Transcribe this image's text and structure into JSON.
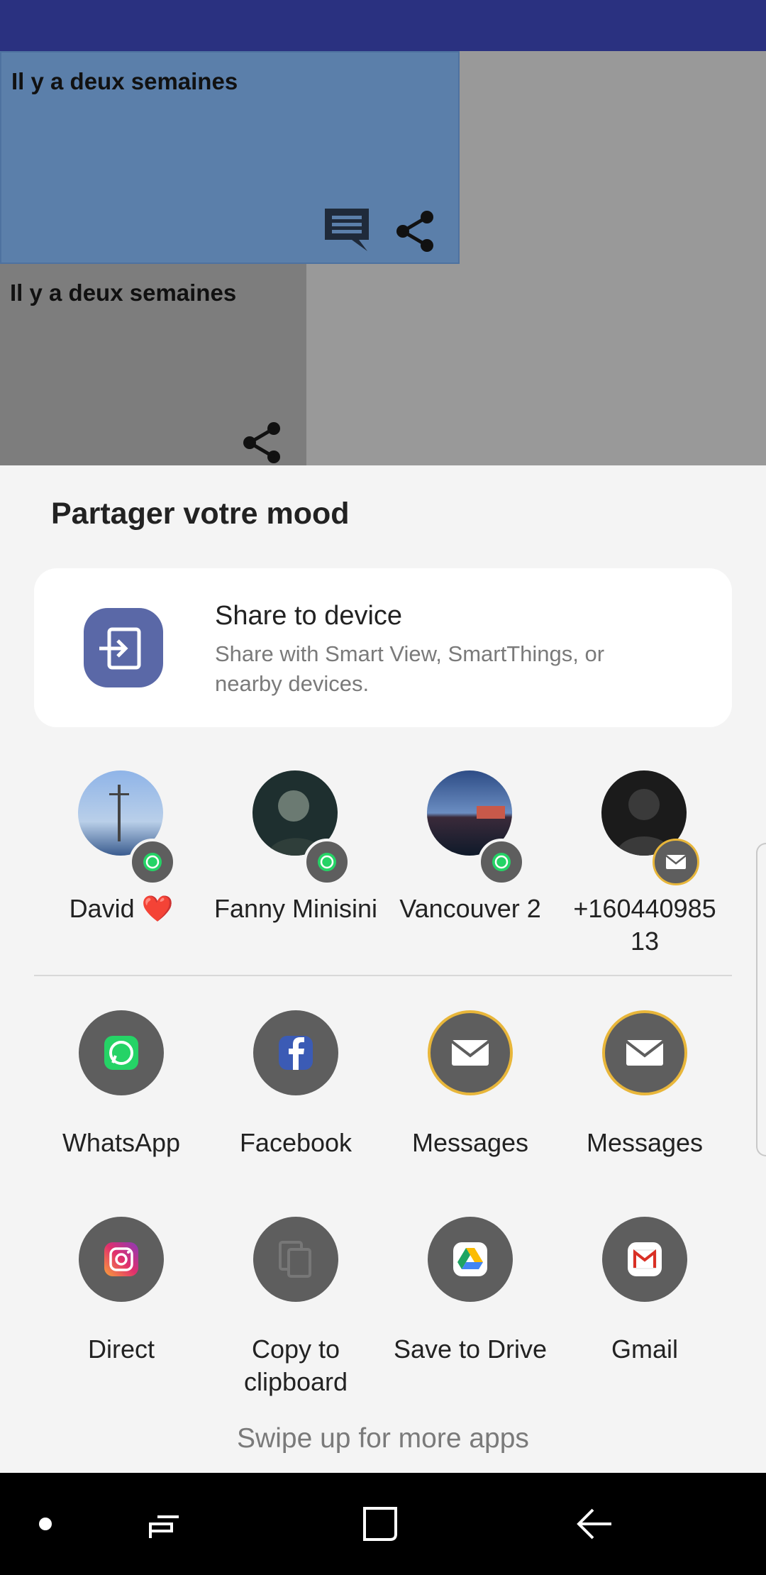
{
  "app": {
    "cards": [
      {
        "title": "Il y a deux semaines"
      },
      {
        "title": "Il y a deux semaines"
      }
    ]
  },
  "sheet": {
    "title": "Partager votre mood",
    "share_device": {
      "title": "Share to device",
      "subtitle": "Share with Smart View, SmartThings, or nearby devices."
    },
    "contacts": [
      {
        "name": "David ❤️",
        "badge": "whatsapp-icon"
      },
      {
        "name": "Fanny Minisini",
        "badge": "whatsapp-icon"
      },
      {
        "name": "Vancouver 2",
        "badge": "whatsapp-icon"
      },
      {
        "name": "+16044098513",
        "badge": "mail-icon"
      }
    ],
    "apps_row1": [
      {
        "label": "WhatsApp",
        "icon": "whatsapp-icon"
      },
      {
        "label": "Facebook",
        "icon": "facebook-icon"
      },
      {
        "label": "Messages",
        "icon": "messages-icon"
      },
      {
        "label": "Messages",
        "icon": "messages-icon"
      }
    ],
    "apps_row2": [
      {
        "label": "Direct",
        "icon": "instagram-icon"
      },
      {
        "label": "Copy to clipboard",
        "icon": "copy-icon"
      },
      {
        "label": "Save to Drive",
        "icon": "drive-icon"
      },
      {
        "label": "Gmail",
        "icon": "gmail-icon"
      }
    ],
    "swipe_hint": "Swipe up for more apps"
  },
  "colors": {
    "appbar": "#2a3180",
    "card_selected": "#5b7faa",
    "sheet_bg": "#f4f4f4",
    "device_icon": "#5a68a7",
    "messages_ring": "#e8b63a",
    "whatsapp_green": "#25d366"
  }
}
